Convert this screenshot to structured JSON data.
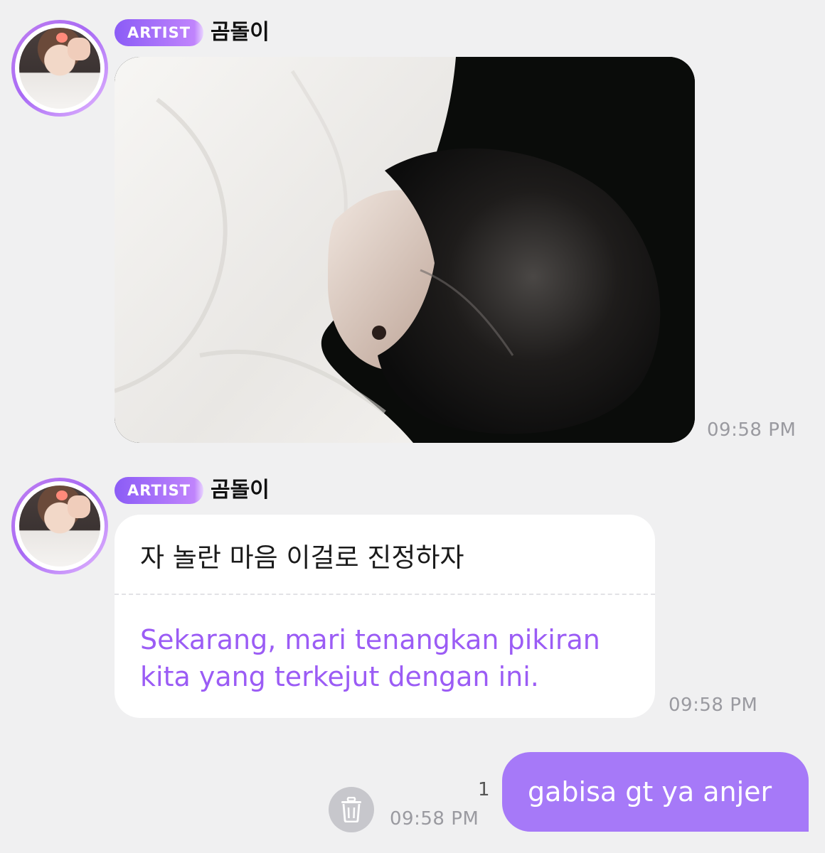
{
  "messages": [
    {
      "sender_badge": "ARTIST",
      "sender_name": "곰돌이",
      "type": "image",
      "time": "09:58 PM"
    },
    {
      "sender_badge": "ARTIST",
      "sender_name": "곰돌이",
      "type": "text",
      "original": "자 놀란 마음 이걸로 진정하자",
      "translation": "Sekarang, mari tenangkan pikiran kita yang terkejut dengan ini.",
      "time": "09:58 PM"
    }
  ],
  "my_message": {
    "text": "gabisa gt ya anjer",
    "read_count": "1",
    "time": "09:58 PM"
  },
  "icons": {
    "delete": "trash-icon"
  },
  "colors": {
    "background": "#f0f0f1",
    "accent": "#a679f8",
    "translation": "#9b5cf5",
    "timestamp": "#9a9aa0"
  }
}
